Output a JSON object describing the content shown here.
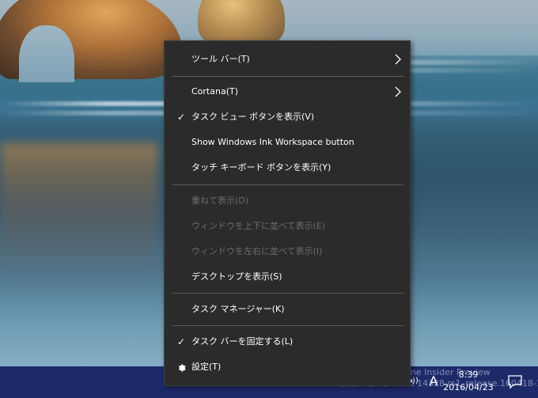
{
  "menu": {
    "items": [
      {
        "label": "ツール バー(T)",
        "has_submenu": true,
        "checked": false,
        "enabled": true
      },
      {
        "label": "Cortana(T)",
        "has_submenu": true,
        "checked": false,
        "enabled": true
      },
      {
        "label": "タスク ビュー ボタンを表示(V)",
        "has_submenu": false,
        "checked": true,
        "enabled": true
      },
      {
        "label": "Show Windows Ink Workspace button",
        "has_submenu": false,
        "checked": false,
        "enabled": true
      },
      {
        "label": "タッチ キーボード ボタンを表示(Y)",
        "has_submenu": false,
        "checked": false,
        "enabled": true
      },
      {
        "label": "重ねて表示(D)",
        "has_submenu": false,
        "checked": false,
        "enabled": false
      },
      {
        "label": "ウィンドウを上下に並べて表示(E)",
        "has_submenu": false,
        "checked": false,
        "enabled": false
      },
      {
        "label": "ウィンドウを左右に並べて表示(I)",
        "has_submenu": false,
        "checked": false,
        "enabled": false
      },
      {
        "label": "デスクトップを表示(S)",
        "has_submenu": false,
        "checked": false,
        "enabled": true
      },
      {
        "label": "タスク マネージャー(K)",
        "has_submenu": false,
        "checked": false,
        "enabled": true
      },
      {
        "label": "タスク バーを固定する(L)",
        "has_submenu": false,
        "checked": true,
        "enabled": true
      },
      {
        "label": "設定(T)",
        "has_submenu": false,
        "checked": false,
        "enabled": true,
        "icon": "gear-icon"
      }
    ],
    "check_glyph": "✓"
  },
  "taskbar": {
    "watermark_line1": "Windows 10 Home Insider Preview",
    "watermark_line2": "評価コピー。Build 14328.rs1_release.160418-1609",
    "ime_indicator": "A",
    "clock_time": "8:39",
    "clock_date": "2016/04/23",
    "tray_chevron": "◂))",
    "notification_icon": "action-center-icon"
  },
  "colors": {
    "menu_bg": "#2b2b2b",
    "menu_text": "#ffffff",
    "menu_disabled_text": "#6d6d6d",
    "taskbar_bg": "#1d2a6a"
  }
}
